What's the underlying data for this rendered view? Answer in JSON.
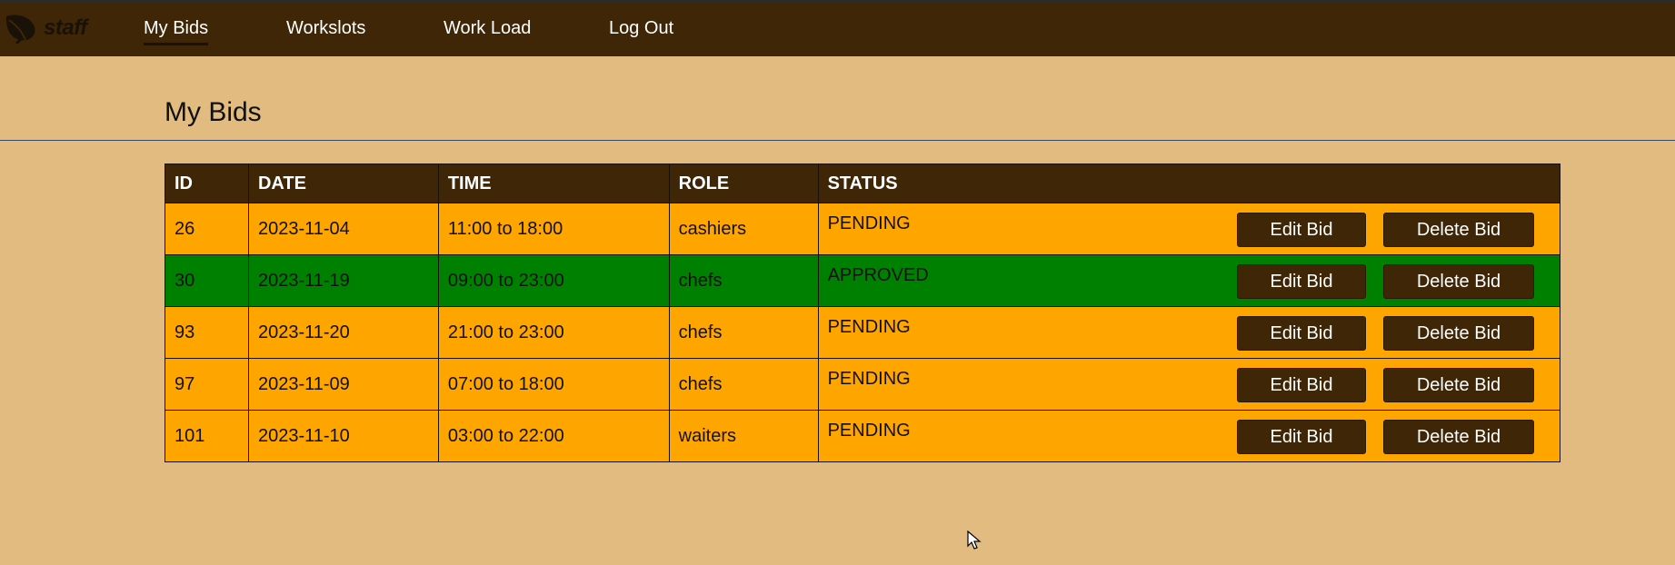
{
  "nav": {
    "logo_text": "staff",
    "items": [
      {
        "label": "My Bids"
      },
      {
        "label": "Workslots"
      },
      {
        "label": "Work Load"
      },
      {
        "label": "Log Out"
      }
    ]
  },
  "page": {
    "title": "My Bids"
  },
  "table": {
    "headers": [
      "ID",
      "DATE",
      "TIME",
      "ROLE",
      "STATUS"
    ],
    "rows": [
      {
        "id": "26",
        "date": "2023-11-04",
        "time": "11:00 to 18:00",
        "role": "cashiers",
        "status": "PENDING",
        "edit": "Edit Bid",
        "delete": "Delete Bid"
      },
      {
        "id": "30",
        "date": "2023-11-19",
        "time": "09:00 to 23:00",
        "role": "chefs",
        "status": "APPROVED",
        "edit": "Edit Bid",
        "delete": "Delete Bid"
      },
      {
        "id": "93",
        "date": "2023-11-20",
        "time": "21:00 to 23:00",
        "role": "chefs",
        "status": "PENDING",
        "edit": "Edit Bid",
        "delete": "Delete Bid"
      },
      {
        "id": "97",
        "date": "2023-11-09",
        "time": "07:00 to 18:00",
        "role": "chefs",
        "status": "PENDING",
        "edit": "Edit Bid",
        "delete": "Delete Bid"
      },
      {
        "id": "101",
        "date": "2023-11-10",
        "time": "03:00 to 22:00",
        "role": "waiters",
        "status": "PENDING",
        "edit": "Edit Bid",
        "delete": "Delete Bid"
      }
    ]
  },
  "colors": {
    "background": "#e2bb80",
    "navbar": "#3e2606",
    "pending_row": "#ffa500",
    "approved_row": "#008000",
    "button": "#3e2606"
  }
}
